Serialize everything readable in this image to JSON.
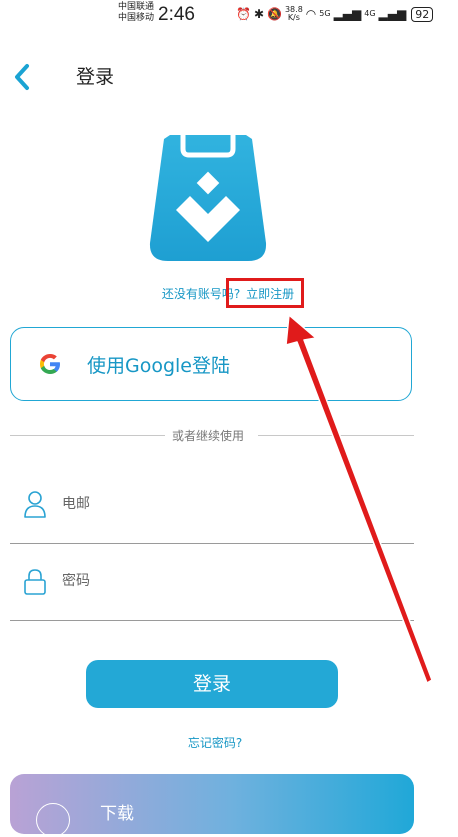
{
  "status_bar": {
    "carrier_1": "中国联通",
    "carrier_2": "中国移动",
    "time": "2:46",
    "net_speed_value": "38.8",
    "net_speed_unit": "K/s",
    "net_type_1": "5G",
    "net_type_2": "4G",
    "battery": "92",
    "icons": [
      "alarm-icon",
      "bluetooth-icon",
      "mute-icon",
      "wifi-icon",
      "signal-icon",
      "battery-icon"
    ]
  },
  "header": {
    "back_icon": "chevron-left-icon",
    "title": "登录"
  },
  "register_prompt": {
    "question": "还没有账号吗?",
    "link": "立即注册"
  },
  "google_button": {
    "label": "使用Google登陆",
    "icon": "google-icon"
  },
  "divider_text": "或者继续使用",
  "email": {
    "placeholder": "电邮",
    "icon": "user-icon"
  },
  "password": {
    "placeholder": "密码",
    "icon": "lock-icon"
  },
  "login_button": "登录",
  "forgot_password": "忘记密码?",
  "download_banner": {
    "label": "下载"
  },
  "colors": {
    "accent": "#23a8d6",
    "link": "#1797c5",
    "annotation": "#e01b1b"
  }
}
